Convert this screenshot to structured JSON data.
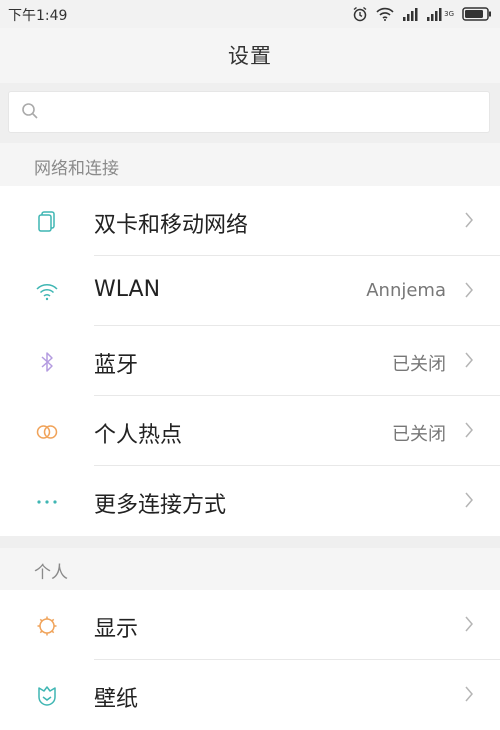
{
  "status": {
    "time": "下午1:49",
    "network_label": "3G"
  },
  "header": {
    "title": "设置"
  },
  "search": {
    "placeholder": ""
  },
  "sections": [
    {
      "title": "网络和连接",
      "items": [
        {
          "label": "双卡和移动网络",
          "value": "",
          "icon": "sim-card-icon"
        },
        {
          "label": "WLAN",
          "value": "Annjema",
          "icon": "wifi-icon"
        },
        {
          "label": "蓝牙",
          "value": "已关闭",
          "icon": "bluetooth-icon"
        },
        {
          "label": "个人热点",
          "value": "已关闭",
          "icon": "hotspot-icon"
        },
        {
          "label": "更多连接方式",
          "value": "",
          "icon": "more-icon"
        }
      ]
    },
    {
      "title": "个人",
      "items": [
        {
          "label": "显示",
          "value": "",
          "icon": "display-icon"
        },
        {
          "label": "壁纸",
          "value": "",
          "icon": "wallpaper-icon"
        }
      ]
    }
  ],
  "colors": {
    "teal": "#3fb6b3",
    "purple": "#b49be0",
    "orange": "#f0a35a",
    "chevron": "#b5b5b5"
  }
}
